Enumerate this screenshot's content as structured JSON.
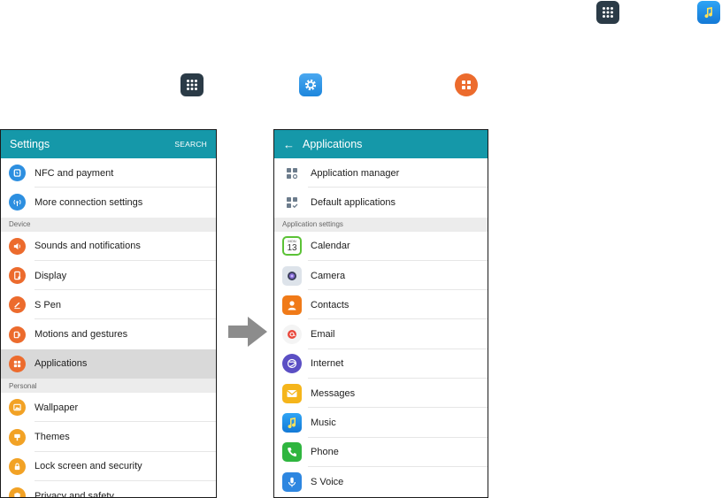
{
  "left_screen": {
    "title": "Settings",
    "search_label": "SEARCH",
    "items": [
      {
        "label": "NFC and payment",
        "icon": "nfc-icon"
      },
      {
        "label": "More connection settings",
        "icon": "connection-icon"
      }
    ],
    "section_device": "Device",
    "device_items": [
      {
        "label": "Sounds and notifications",
        "icon": "speaker-icon"
      },
      {
        "label": "Display",
        "icon": "display-icon"
      },
      {
        "label": "S Pen",
        "icon": "pen-icon"
      },
      {
        "label": "Motions and gestures",
        "icon": "motion-icon"
      },
      {
        "label": "Applications",
        "icon": "apps-grid-icon",
        "selected": true
      }
    ],
    "section_personal": "Personal",
    "personal_items": [
      {
        "label": "Wallpaper",
        "icon": "wallpaper-icon"
      },
      {
        "label": "Themes",
        "icon": "brush-icon"
      },
      {
        "label": "Lock screen and security",
        "icon": "lock-icon"
      },
      {
        "label": "Privacy and safety",
        "icon": "privacy-icon"
      }
    ]
  },
  "right_screen": {
    "title": "Applications",
    "items": [
      {
        "label": "Application manager",
        "icon": "app-manager-icon"
      },
      {
        "label": "Default applications",
        "icon": "default-apps-icon"
      }
    ],
    "section": "Application settings",
    "apps": [
      {
        "label": "Calendar",
        "icon": "calendar-icon",
        "cal_day": "MON",
        "cal_date": "13"
      },
      {
        "label": "Camera",
        "icon": "camera-icon"
      },
      {
        "label": "Contacts",
        "icon": "contacts-icon"
      },
      {
        "label": "Email",
        "icon": "email-icon"
      },
      {
        "label": "Internet",
        "icon": "internet-icon"
      },
      {
        "label": "Messages",
        "icon": "messages-icon"
      },
      {
        "label": "Music",
        "icon": "music-icon"
      },
      {
        "label": "Phone",
        "icon": "phone-icon"
      },
      {
        "label": "S Voice",
        "icon": "voice-icon"
      }
    ]
  },
  "colors": {
    "appbar": "#1598a9",
    "selected_row": "#d9d9d9",
    "section_bg": "#ececec",
    "orange_icon": "#ec6b2d",
    "blue_icon": "#2d8fe0"
  }
}
